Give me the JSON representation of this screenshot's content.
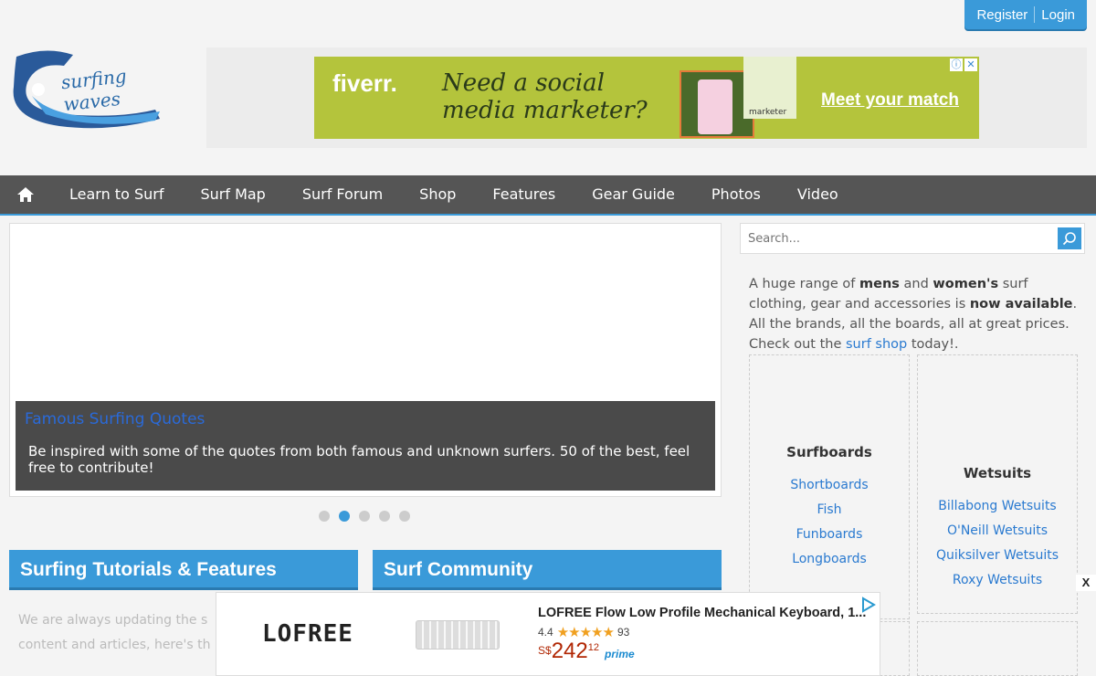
{
  "auth": {
    "register": "Register",
    "login": "Login"
  },
  "logo": {
    "text": "surfing waves"
  },
  "top_ad": {
    "brand": "fiverr.",
    "headline": "Need a social media marketer?",
    "cta": "Meet your match",
    "card_text": "marketer"
  },
  "nav": {
    "items": [
      "Learn to Surf",
      "Surf Map",
      "Surf Forum",
      "Shop",
      "Features",
      "Gear Guide",
      "Photos",
      "Video"
    ]
  },
  "slider": {
    "title": "Famous Surfing Quotes",
    "description": "Be inspired with some of the quotes from both famous and unknown surfers. 50 of the best, feel free to contribute!",
    "dots": 5,
    "active_dot": 2
  },
  "sections": {
    "tutorials": "Surfing Tutorials & Features",
    "community": "Surf Community",
    "body_line1": "We are always updating the s",
    "body_line2": "content and articles, here's th"
  },
  "search": {
    "placeholder": "Search..."
  },
  "promo": {
    "t1": "A huge range of ",
    "mens": "mens",
    "t2": " and ",
    "womens": "women's",
    "t3": " surf clothing, gear and accessories is ",
    "now": "now available",
    "t4": ". All the brands, all the boards, all at great prices. Check out the ",
    "link": "surf shop",
    "t5": " today!."
  },
  "categories": [
    {
      "title": "Surfboards",
      "links": [
        "Shortboards",
        "Fish",
        "Funboards",
        "Longboards"
      ]
    },
    {
      "title": "Wetsuits",
      "links": [
        "Billabong Wetsuits",
        "O'Neill Wetsuits",
        "Quiksilver Wetsuits",
        "Roxy Wetsuits"
      ]
    }
  ],
  "bottom_ad": {
    "logo": "LOFREE",
    "title": "LOFREE Flow Low Profile Mechanical Keyboard, 1...",
    "rating": "4.4",
    "stars": "★★★★★",
    "reviews": "93",
    "currency": "S$",
    "price": "242",
    "cents": "12",
    "prime": "prime",
    "close": "X"
  },
  "colors": {
    "accent": "#3a9ad9",
    "nav_bg": "#555555",
    "link": "#2a7ad0"
  }
}
